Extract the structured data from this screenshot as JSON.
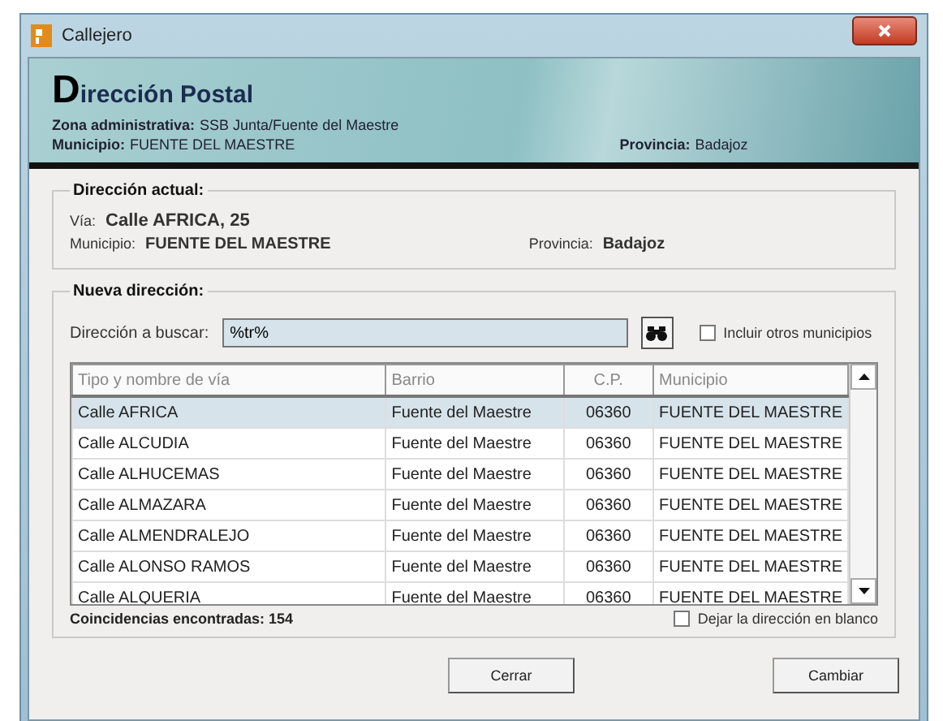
{
  "window": {
    "title": "Callejero"
  },
  "header": {
    "title": "Dirección Postal",
    "zona_label": "Zona administrativa:",
    "zona_value": "SSB Junta/Fuente del Maestre",
    "municipio_label": "Municipio:",
    "municipio_value": "FUENTE DEL MAESTRE",
    "provincia_label": "Provincia:",
    "provincia_value": "Badajoz"
  },
  "current_address": {
    "legend": "Dirección actual:",
    "via_label": "Vía:",
    "via_value": "Calle AFRICA, 25",
    "municipio_label": "Municipio:",
    "municipio_value": "FUENTE DEL MAESTRE",
    "provincia_label": "Provincia:",
    "provincia_value": "Badajoz"
  },
  "new_address": {
    "legend": "Nueva dirección:",
    "search_label": "Dirección a buscar:",
    "search_value": "%tr%",
    "include_others": {
      "label": "Incluir otros municipios",
      "checked": false
    },
    "table": {
      "columns": [
        "Tipo y nombre de vía",
        "Barrio",
        "C.P.",
        "Municipio"
      ],
      "rows": [
        {
          "cells": [
            "Calle AFRICA",
            "Fuente del Maestre",
            "06360",
            "FUENTE DEL MAESTRE"
          ],
          "selected": true
        },
        {
          "cells": [
            "Calle ALCUDIA",
            "Fuente del Maestre",
            "06360",
            "FUENTE DEL MAESTRE"
          ],
          "selected": false
        },
        {
          "cells": [
            "Calle ALHUCEMAS",
            "Fuente del Maestre",
            "06360",
            "FUENTE DEL MAESTRE"
          ],
          "selected": false
        },
        {
          "cells": [
            "Calle ALMAZARA",
            "Fuente del Maestre",
            "06360",
            "FUENTE DEL MAESTRE"
          ],
          "selected": false
        },
        {
          "cells": [
            "Calle ALMENDRALEJO",
            "Fuente del Maestre",
            "06360",
            "FUENTE DEL MAESTRE"
          ],
          "selected": false
        },
        {
          "cells": [
            "Calle ALONSO RAMOS",
            "Fuente del Maestre",
            "06360",
            "FUENTE DEL MAESTRE"
          ],
          "selected": false
        },
        {
          "cells": [
            "Calle ALQUERIA",
            "Fuente del Maestre",
            "06360",
            "FUENTE DEL MAESTRE"
          ],
          "selected": false
        }
      ]
    },
    "matches": "Coincidencias encontradas: 154",
    "leave_blank": {
      "label": "Dejar la dirección en blanco",
      "checked": false
    }
  },
  "buttons": [
    "Cerrar",
    "Cambiar"
  ]
}
